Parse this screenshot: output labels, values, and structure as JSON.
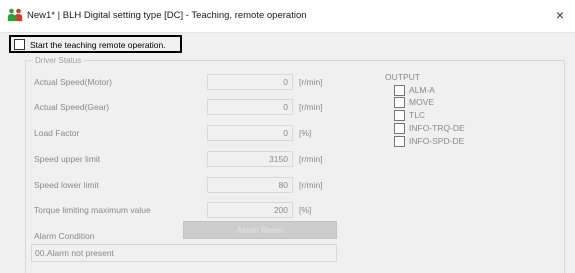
{
  "window": {
    "title": "New1* | BLH Digital setting type [DC] - Teaching, remote operation",
    "app_icon": "two-persons-icon",
    "close_glyph": "×"
  },
  "teaching": {
    "label": "Start the teaching remote operation.",
    "checked": false
  },
  "driver_status": {
    "group_title": "Driver Status",
    "rows": [
      {
        "label": "Actual Speed(Motor)",
        "value": "0",
        "unit": "[r/min]"
      },
      {
        "label": "Actual Speed(Gear)",
        "value": "0",
        "unit": "[r/min]"
      },
      {
        "label": "Load Factor",
        "value": "0",
        "unit": "[%]"
      },
      {
        "label": "Speed upper limit",
        "value": "3150",
        "unit": "[r/min]"
      },
      {
        "label": "Speed lower limit",
        "value": "80",
        "unit": "[r/min]"
      },
      {
        "label": "Torque limiting maximum value",
        "value": "200",
        "unit": "[%]"
      }
    ],
    "alarm_label": "Alarm Condition",
    "alarm_reset_label": "Alarm Reset",
    "alarm_value": "00.Alarm not present"
  },
  "output": {
    "label": "OUTPUT",
    "items": [
      {
        "label": "ALM-A",
        "checked": false
      },
      {
        "label": "MOVE",
        "checked": false
      },
      {
        "label": "TLC",
        "checked": false
      },
      {
        "label": "INFO-TRQ-DE",
        "checked": false
      },
      {
        "label": "INFO-SPD-DE",
        "checked": false
      }
    ]
  },
  "colors": {
    "client_bg": "#f0f0f0",
    "disabled_text": "#8a8a8a",
    "highlight_border": "#000000",
    "icon_green": "#2e9e3a",
    "icon_red": "#d63a2a"
  }
}
